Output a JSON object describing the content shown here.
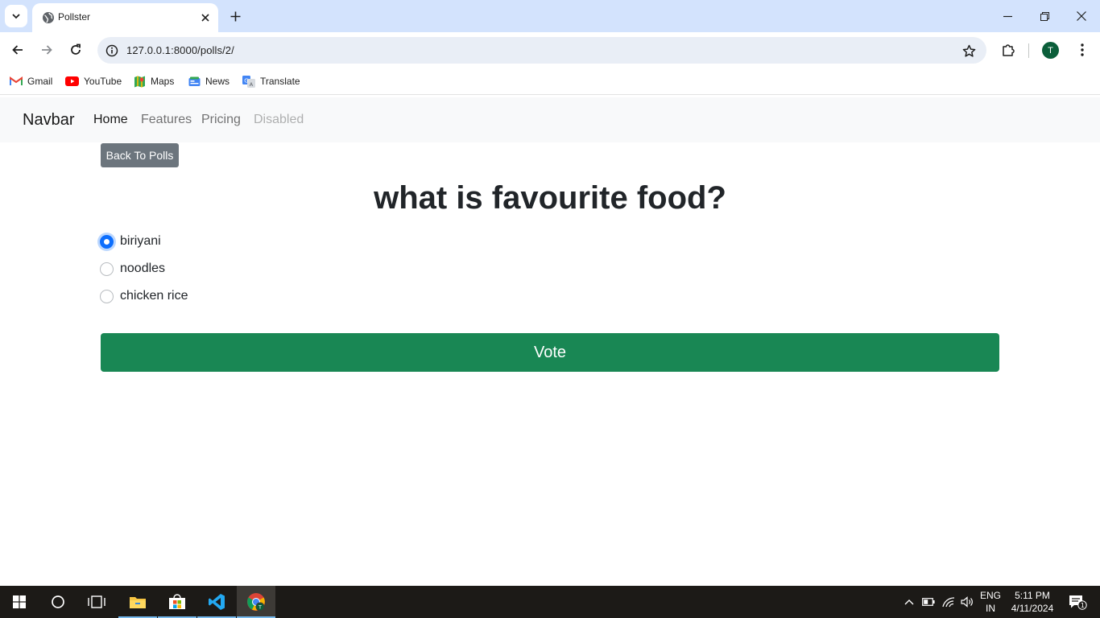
{
  "browser": {
    "tab_title": "Pollster",
    "url": "127.0.0.1:8000/polls/2/",
    "profile_initial": "T",
    "bookmarks": [
      {
        "label": "Gmail",
        "icon": "gmail-icon"
      },
      {
        "label": "YouTube",
        "icon": "youtube-icon"
      },
      {
        "label": "Maps",
        "icon": "maps-icon"
      },
      {
        "label": "News",
        "icon": "news-icon"
      },
      {
        "label": "Translate",
        "icon": "translate-icon"
      }
    ]
  },
  "navbar": {
    "brand": "Navbar",
    "links": [
      {
        "label": "Home",
        "state": "active"
      },
      {
        "label": "Features",
        "state": "normal"
      },
      {
        "label": "Pricing",
        "state": "normal"
      },
      {
        "label": "Disabled",
        "state": "disabled"
      }
    ]
  },
  "poll": {
    "back_label": "Back To Polls",
    "question": "what is favourite food?",
    "choices": [
      {
        "label": "biriyani",
        "checked": true
      },
      {
        "label": "noodles",
        "checked": false
      },
      {
        "label": "chicken rice",
        "checked": false
      }
    ],
    "vote_label": "Vote"
  },
  "colors": {
    "primary": "#0d6efd",
    "success": "#198754",
    "secondary": "#6c757d",
    "navbar_bg": "#f8f9fa"
  },
  "taskbar": {
    "language": "ENG",
    "region": "IN",
    "time": "5:11 PM",
    "date": "4/11/2024",
    "notification_count": "1"
  }
}
